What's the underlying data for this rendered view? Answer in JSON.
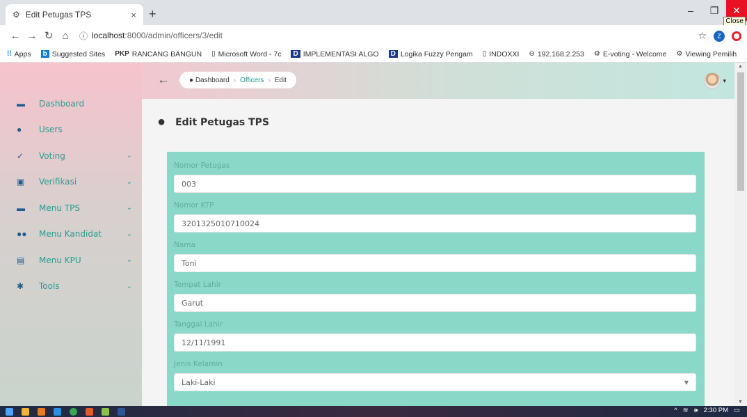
{
  "browser": {
    "tab_title": "Edit Petugas TPS",
    "tab_close": "×",
    "new_tab": "+",
    "close_tooltip": "Close",
    "url_host": "localhost",
    "url_path": ":8000/admin/officers/3/edit",
    "profile_initial": "Z",
    "bookmarks": [
      {
        "icon": "apps-icon",
        "label": "Apps"
      },
      {
        "icon": "bing-icon",
        "label": "Suggested Sites"
      },
      {
        "icon": "pkp-icon",
        "label": "RANCANG BANGUN"
      },
      {
        "icon": "page-icon",
        "label": "Microsoft Word - 7c"
      },
      {
        "icon": "d-icon",
        "label": "IMPLEMENTASI ALGO"
      },
      {
        "icon": "d-icon",
        "label": "Logika Fuzzy Pengam"
      },
      {
        "icon": "page-icon",
        "label": "INDOXXI"
      },
      {
        "icon": "globe-icon",
        "label": "192.168.2.253"
      },
      {
        "icon": "gear-icon",
        "label": "E-voting - Welcome"
      },
      {
        "icon": "gear-icon",
        "label": "Viewing Pemilih"
      }
    ]
  },
  "breadcrumb": {
    "home": "Dashboard",
    "officers": "Officers",
    "current": "Edit",
    "sep": "›"
  },
  "sidebar": {
    "items": [
      {
        "label": "Dashboard",
        "icon": "dashboard-icon",
        "has_chevron": false
      },
      {
        "label": "Users",
        "icon": "user-icon",
        "has_chevron": false
      },
      {
        "label": "Voting",
        "icon": "check-icon",
        "has_chevron": true
      },
      {
        "label": "Verifikasi",
        "icon": "verify-icon",
        "has_chevron": true
      },
      {
        "label": "Menu TPS",
        "icon": "folder-icon",
        "has_chevron": true
      },
      {
        "label": "Menu Kandidat",
        "icon": "users-icon",
        "has_chevron": true
      },
      {
        "label": "Menu KPU",
        "icon": "building-icon",
        "has_chevron": true
      },
      {
        "label": "Tools",
        "icon": "tools-icon",
        "has_chevron": true
      }
    ]
  },
  "page": {
    "title": "Edit Petugas TPS"
  },
  "form": {
    "fields": [
      {
        "label": "Nomor Petugas",
        "value": "003"
      },
      {
        "label": "Nomor KTP",
        "value": "3201325010710024"
      },
      {
        "label": "Nama",
        "value": "Toni"
      },
      {
        "label": "Tempat Lahir",
        "value": "Garut"
      },
      {
        "label": "Tanggal Lahir",
        "value": "12/11/1991"
      },
      {
        "label": "Jenis Kelamin",
        "value": "Laki-Laki"
      }
    ]
  },
  "taskbar": {
    "time": "2:30 PM"
  },
  "colors": {
    "accent": "#2a9d8f",
    "form_bg": "#8ad8c7"
  }
}
